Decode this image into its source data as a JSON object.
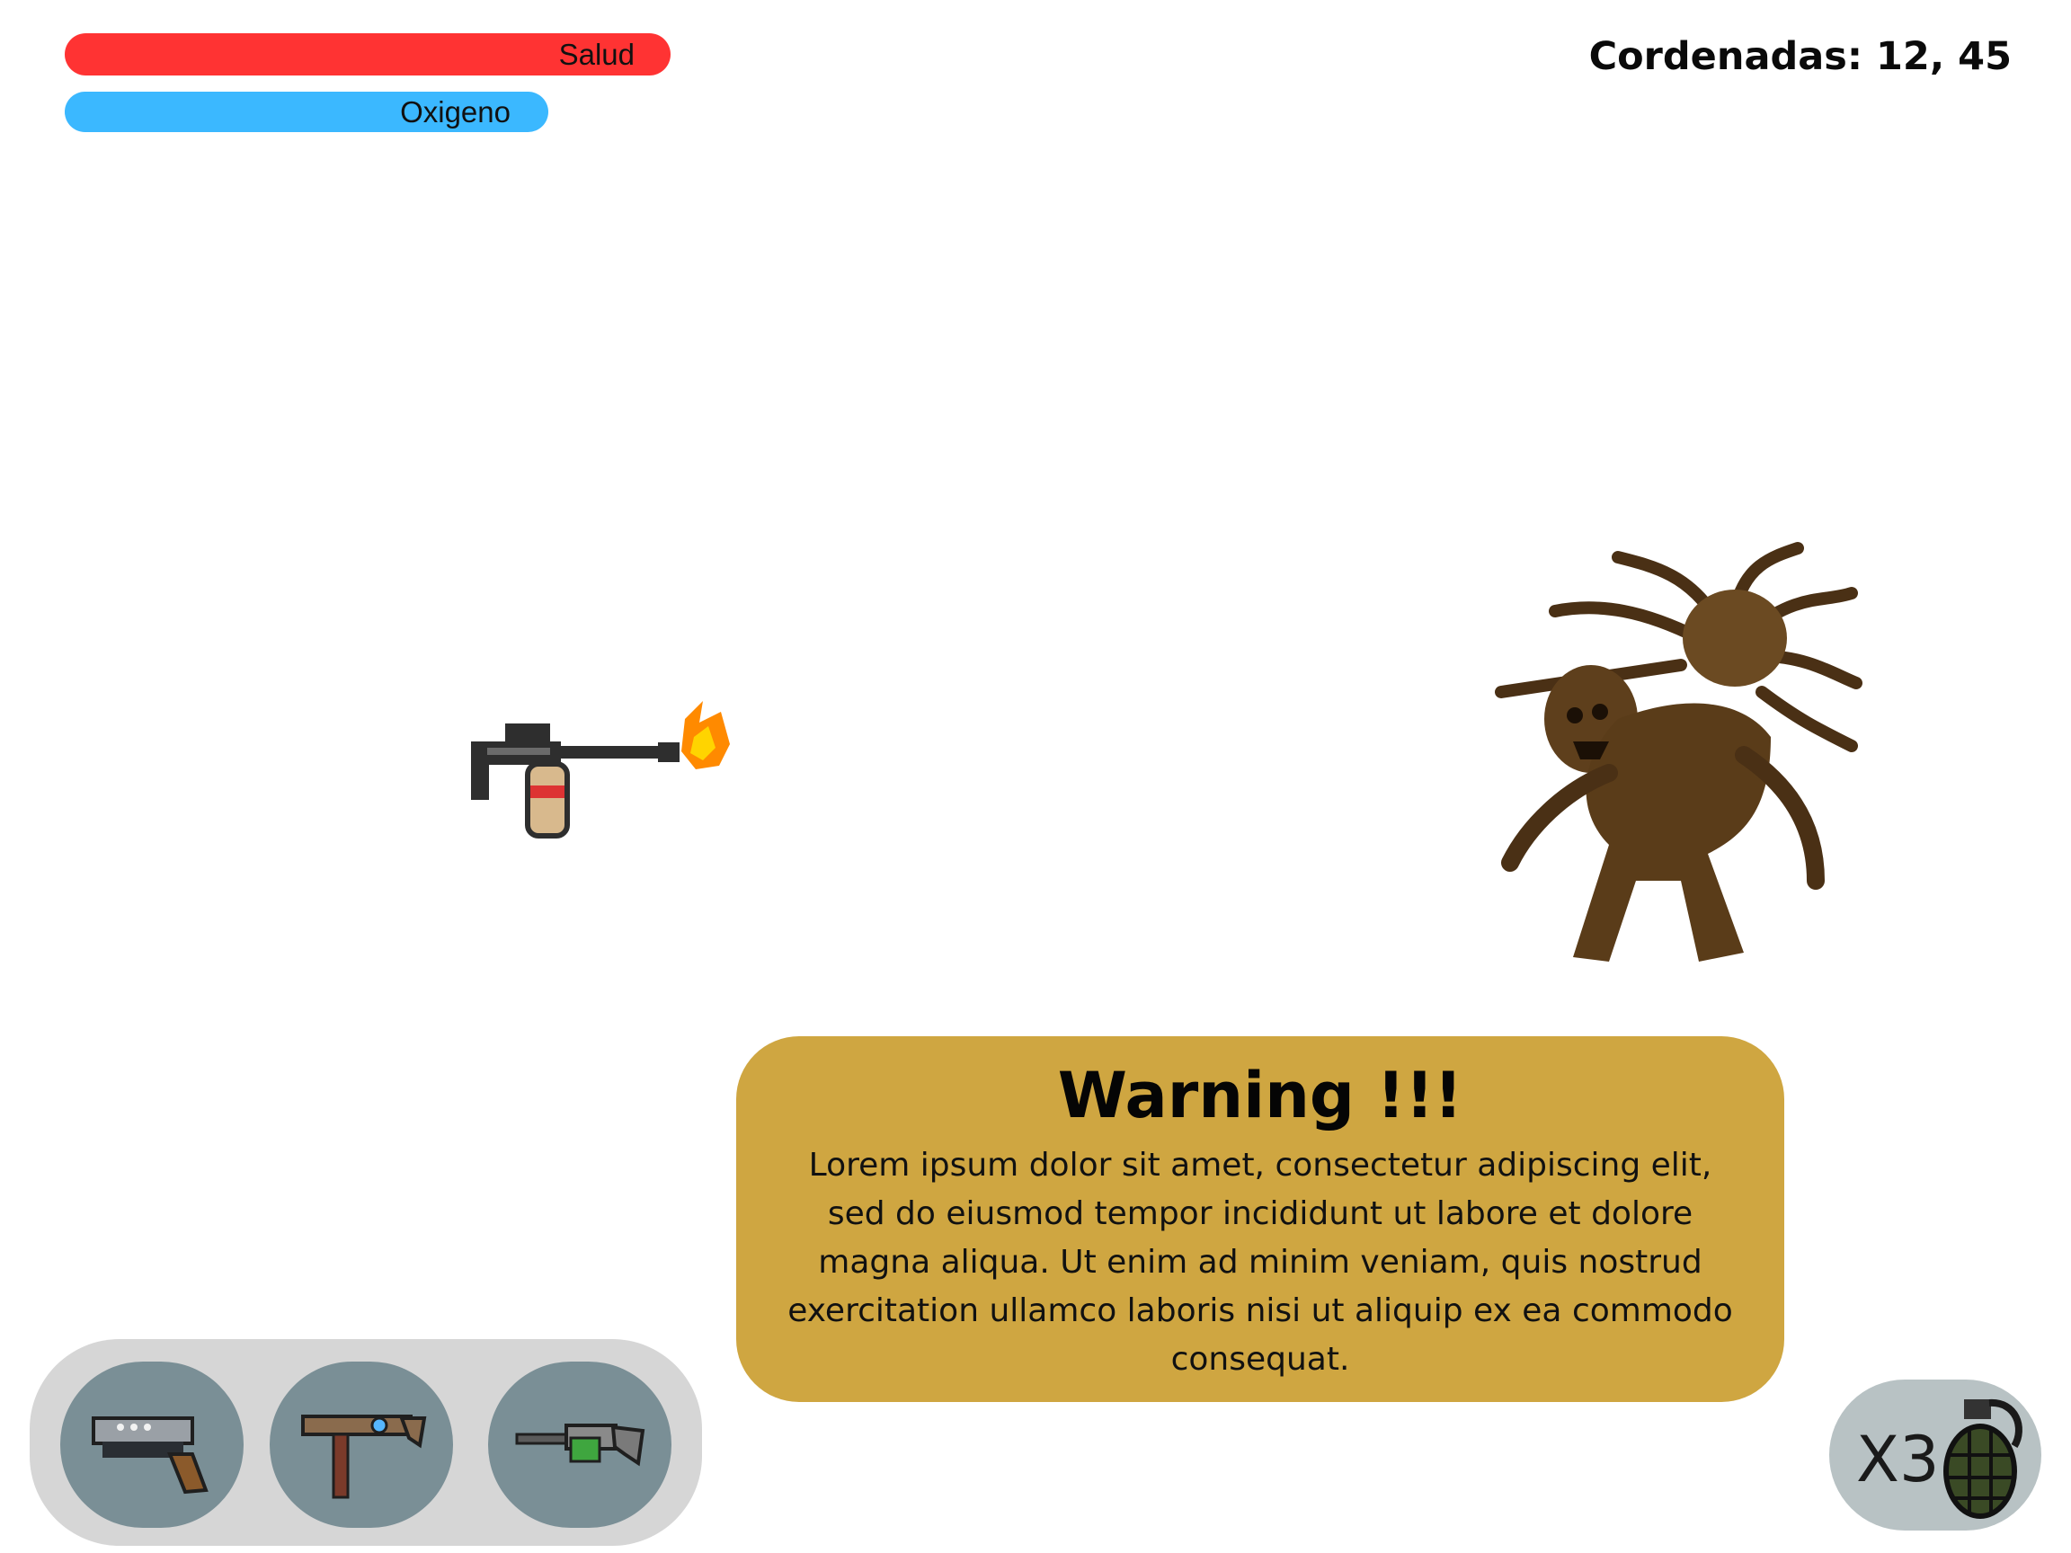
{
  "hud": {
    "health_label": "Salud",
    "health_level": 1.0,
    "oxygen_label": "Oxigeno",
    "oxygen_level": 1.0,
    "coords_text": "Cordenadas: 12, 45"
  },
  "warning": {
    "title": "Warning !!!",
    "body": "Lorem ipsum dolor sit amet, consectetur adipiscing elit, sed do eiusmod tempor incididunt ut labore et dolore magna aliqua. Ut enim ad minim veniam, quis nostrud exercitation ullamco laboris nisi ut aliquip ex ea commodo consequat."
  },
  "hotbar": {
    "slots": [
      {
        "icon": "pistol-icon"
      },
      {
        "icon": "smg-icon"
      },
      {
        "icon": "rifle-icon"
      }
    ]
  },
  "grenades": {
    "count_text": "X3",
    "icon": "grenade-icon"
  },
  "colors": {
    "health": "#ff3333",
    "oxygen": "#3bb8ff",
    "warning_bg": "#cfa641",
    "hotbar_bg": "#d6d6d6",
    "slot_bg": "#7a8f96"
  }
}
